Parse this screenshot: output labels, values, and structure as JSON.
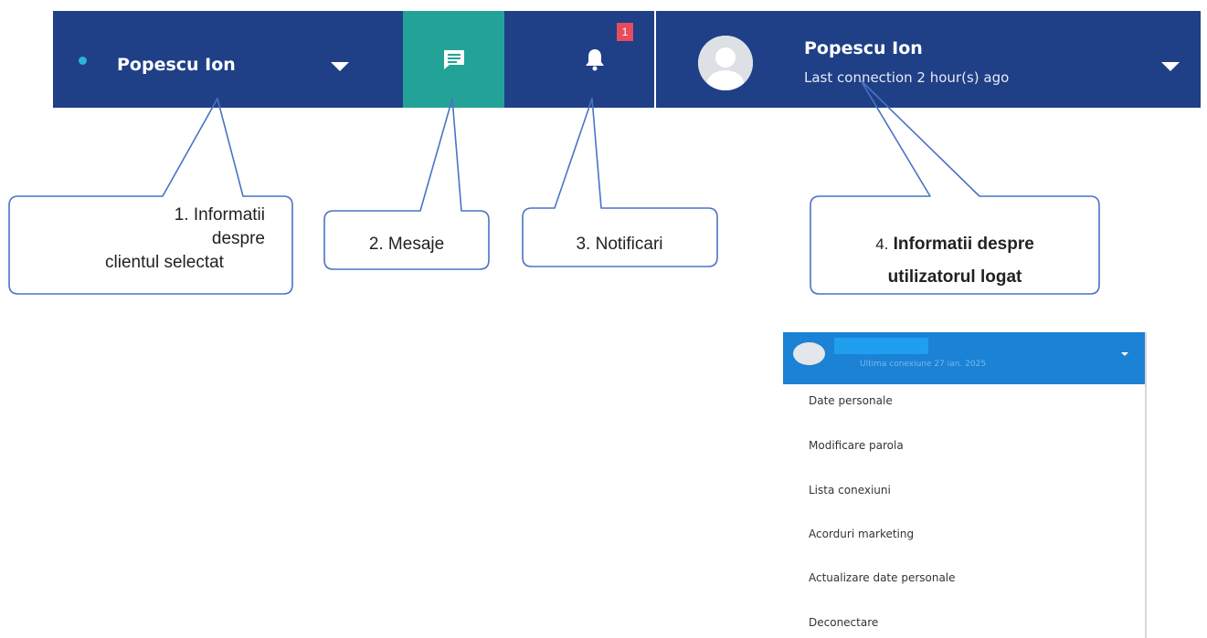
{
  "topbar": {
    "client_name": "Popescu Ion",
    "notification_count": "1",
    "user_name": "Popescu Ion",
    "last_connection": "Last connection 2 hour(s) ago"
  },
  "callouts": {
    "c1_line1": "1. Informatii",
    "c1_line2": "despre",
    "c1_line3": "clientul selectat",
    "c2": "2. Mesaje",
    "c3": "3. Notificari",
    "c4_num": "4.",
    "c4_line1": "Informatii despre",
    "c4_line2": "utilizatorul logat"
  },
  "dropdown": {
    "subtitle": "Ultima conexiune 27 ian. 2025",
    "items": [
      "Date personale",
      "Modificare parola",
      "Lista conexiuni",
      "Acorduri marketing",
      "Actualizare date personale",
      "Deconectare"
    ]
  },
  "colors": {
    "topbar": "#1f3f86",
    "message_button": "#23a397",
    "badge": "#e74c5c",
    "dropdown_header": "#1b82d6"
  },
  "icons": [
    "message-icon",
    "bell-icon",
    "caret-down-icon",
    "avatar-icon"
  ]
}
